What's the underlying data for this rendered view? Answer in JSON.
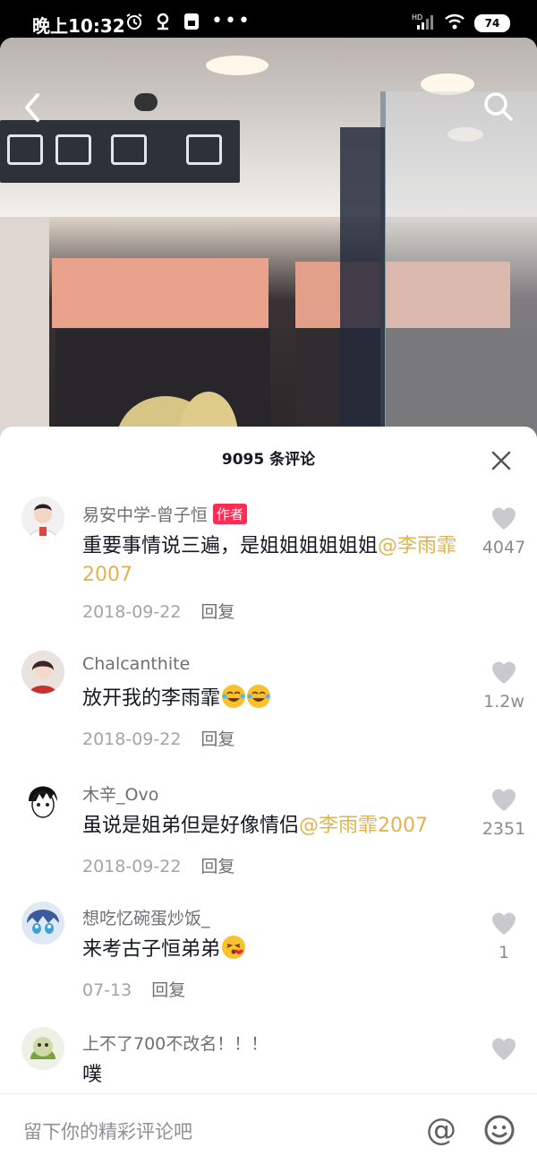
{
  "status_bar": {
    "time": "晚上10:32",
    "battery": "74",
    "signal_label": "HD"
  },
  "sheet": {
    "title": "9095 条评论"
  },
  "comments": [
    {
      "username": "易安中学-曾子恒",
      "badge": "作者",
      "text": "重要事情说三遍，是姐姐姐姐姐姐",
      "mention": "@李雨霏2007",
      "date": "2018-09-22",
      "reply": "回复",
      "likes": "4047"
    },
    {
      "username": "Chalcanthite",
      "text": "放开我的李雨霏",
      "emojis": [
        "laughing-crying-emoji",
        "laughing-crying-emoji"
      ],
      "date": "2018-09-22",
      "reply": "回复",
      "likes": "1.2w"
    },
    {
      "username": "木辛_Ovo",
      "text": "虽说是姐弟但是好像情侣",
      "mention": "@李雨霏2007",
      "date": "2018-09-22",
      "reply": "回复",
      "likes": "2351"
    },
    {
      "username": "想吃忆碗蛋炒饭_",
      "text": "来考古子恒弟弟",
      "emojis": [
        "kiss-emoji"
      ],
      "date": "07-13",
      "reply": "回复",
      "likes": "1"
    },
    {
      "username": "上不了700不改名！！！",
      "text": "噗"
    }
  ],
  "input": {
    "placeholder": "留下你的精彩评论吧"
  },
  "colors": {
    "mention": "#dfb44d",
    "badge": "#fe2c55",
    "text": "#161823",
    "muted": "#a3a4a8"
  }
}
